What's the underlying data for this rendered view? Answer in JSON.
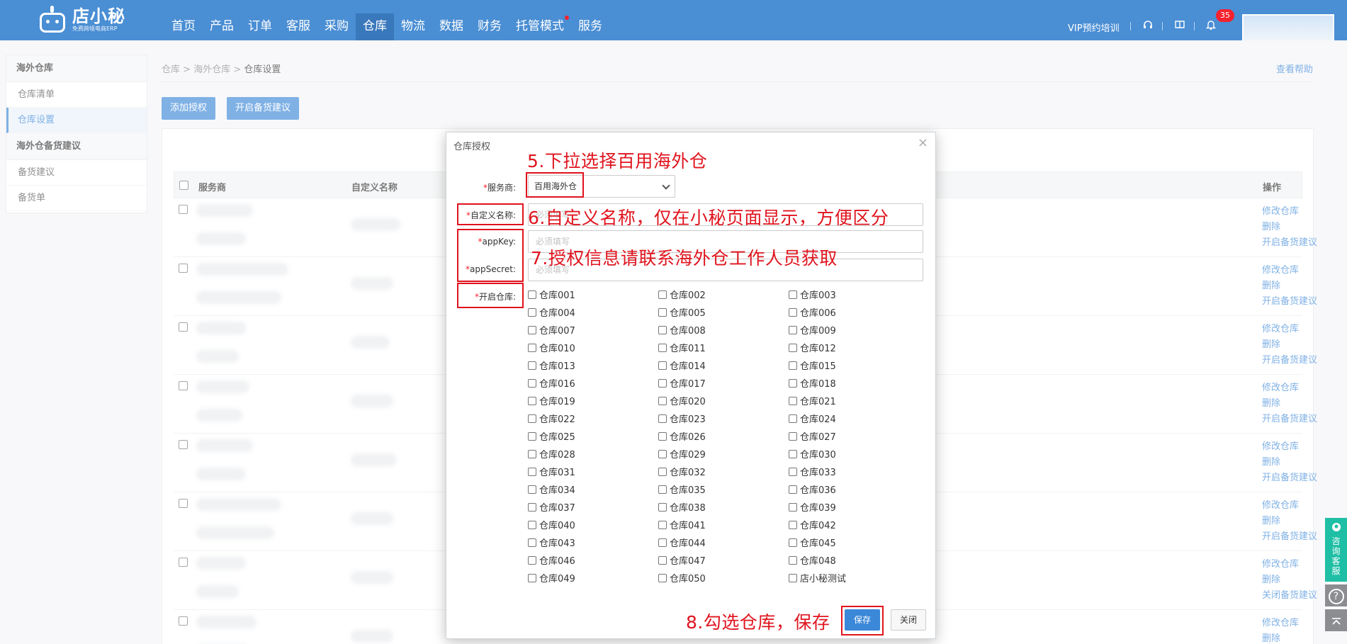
{
  "app": {
    "logo_name": "店小秘",
    "logo_sub": "免费跨境电商ERP"
  },
  "nav": [
    "首页",
    "产品",
    "订单",
    "客服",
    "采购",
    "仓库",
    "物流",
    "数据",
    "财务",
    "托管模式",
    "服务"
  ],
  "nav_active_index": 5,
  "top_right": {
    "vip": "VIP预约培训",
    "notification_count": "35"
  },
  "sidebar": {
    "groups": [
      {
        "title": "海外仓库",
        "items": [
          "仓库清单",
          "仓库设置"
        ]
      },
      {
        "title": "海外仓备货建议",
        "items": [
          "备货建议",
          "备货单"
        ]
      }
    ],
    "active_item": "仓库设置"
  },
  "breadcrumb": [
    "仓库",
    "海外仓库",
    "仓库设置"
  ],
  "help_link": "查看帮助",
  "toolbar": {
    "add_auth": "添加授权",
    "enable_stock": "开启备货建议"
  },
  "table": {
    "headers": [
      "服务商",
      "自定义名称",
      "操作"
    ],
    "rows": [
      {
        "ops": [
          "修改仓库",
          "删除",
          "开启备货建议"
        ]
      },
      {
        "ops": [
          "修改仓库",
          "删除",
          "开启备货建议"
        ]
      },
      {
        "ops": [
          "修改仓库",
          "删除",
          "开启备货建议"
        ]
      },
      {
        "ops": [
          "修改仓库",
          "删除",
          "开启备货建议"
        ]
      },
      {
        "ops": [
          "修改仓库",
          "删除",
          "开启备货建议"
        ]
      },
      {
        "ops": [
          "修改仓库",
          "删除",
          "开启备货建议"
        ]
      },
      {
        "ops": [
          "修改仓库",
          "删除",
          "关闭备货建议"
        ]
      },
      {
        "ops": [
          "修改仓库",
          "删除"
        ]
      }
    ]
  },
  "modal": {
    "title": "仓库授权",
    "close_symbol": "×",
    "labels": {
      "provider": "服务商:",
      "custom_name": "自定义名称:",
      "app_key": "appKey:",
      "app_secret": "appSecret:",
      "warehouses": "开启仓库:"
    },
    "provider_value": "百用海外仓",
    "placeholder": "必须填写",
    "warehouses": [
      "仓库001",
      "仓库002",
      "仓库003",
      "仓库004",
      "仓库005",
      "仓库006",
      "仓库007",
      "仓库008",
      "仓库009",
      "仓库010",
      "仓库011",
      "仓库012",
      "仓库013",
      "仓库014",
      "仓库015",
      "仓库016",
      "仓库017",
      "仓库018",
      "仓库019",
      "仓库020",
      "仓库021",
      "仓库022",
      "仓库023",
      "仓库024",
      "仓库025",
      "仓库026",
      "仓库027",
      "仓库028",
      "仓库029",
      "仓库030",
      "仓库031",
      "仓库032",
      "仓库033",
      "仓库034",
      "仓库035",
      "仓库036",
      "仓库037",
      "仓库038",
      "仓库039",
      "仓库040",
      "仓库041",
      "仓库042",
      "仓库043",
      "仓库044",
      "仓库045",
      "仓库046",
      "仓库047",
      "仓库048",
      "仓库049",
      "仓库050",
      "店小秘测试"
    ],
    "save": "保存",
    "close": "关闭"
  },
  "annotations": [
    "5.下拉选择百用海外仓",
    "6.自定义名称，仅在小秘页面显示，方便区分",
    "7.授权信息请联系海外仓工作人员获取",
    "8.勾选仓库，保存"
  ],
  "float": {
    "customer_service": "咨询客服",
    "help_symbol": "?"
  },
  "colors": {
    "topbar": "#4a8ed4",
    "primary": "#3b87d8",
    "annotation": "#e0141e",
    "float_cs": "#1fbfa5"
  }
}
